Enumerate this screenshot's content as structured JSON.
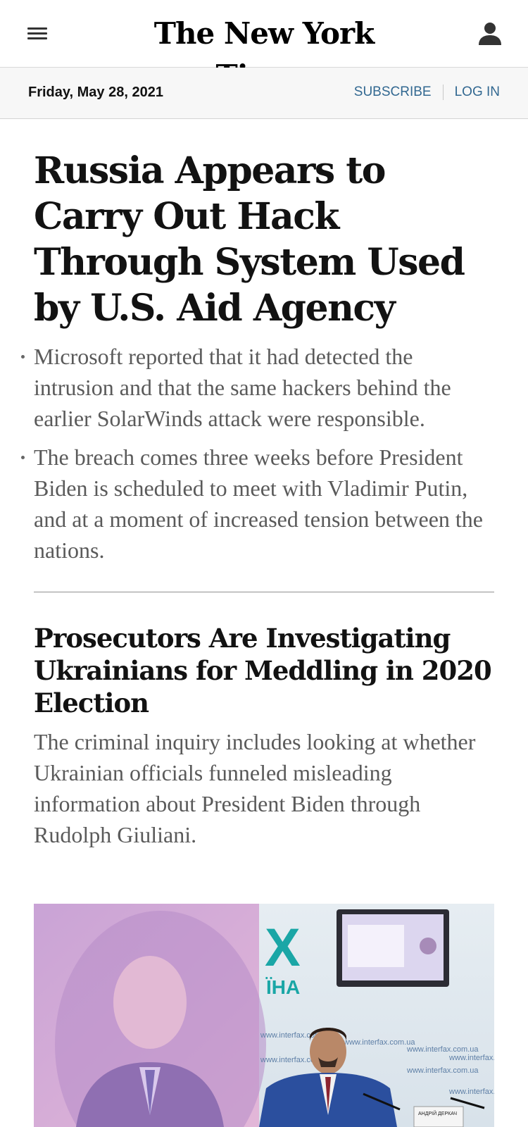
{
  "header": {
    "logo_text": "The New York Times",
    "menu_icon": "hamburger-menu-icon",
    "account_icon": "person-icon"
  },
  "datebar": {
    "date": "Friday, May 28, 2021",
    "subscribe": "SUBSCRIBE",
    "login": "LOG IN"
  },
  "lead_story": {
    "headline": "Russia Appears to Carry Out Hack Through System Used by U.S. Aid Agency",
    "bullets": [
      "Microsoft reported that it had detected the intrusion and that the same hackers behind the earlier SolarWinds attack were responsible.",
      "The breach comes three weeks before President Biden is scheduled to meet with Vladimir Putin, and at a moment of increased tension between the nations."
    ]
  },
  "second_story": {
    "headline": "Prosecutors Are Investigating Ukrainians for Meddling in 2020 Election",
    "summary": "The criminal inquiry includes looking at whether Ukrainian officials funneled misleading information about President Biden through Rudolph Giuliani.",
    "photo": {
      "backdrop_text": "www.interfax.com.ua",
      "logo_letters": "X",
      "logo_sub": "ÏНА",
      "nameplate": "АНДРІЙ ДЕРКАЧ"
    }
  },
  "colors": {
    "link_blue": "#326891",
    "summary_gray": "#5a5a5a",
    "datebar_bg": "#f7f7f7"
  }
}
